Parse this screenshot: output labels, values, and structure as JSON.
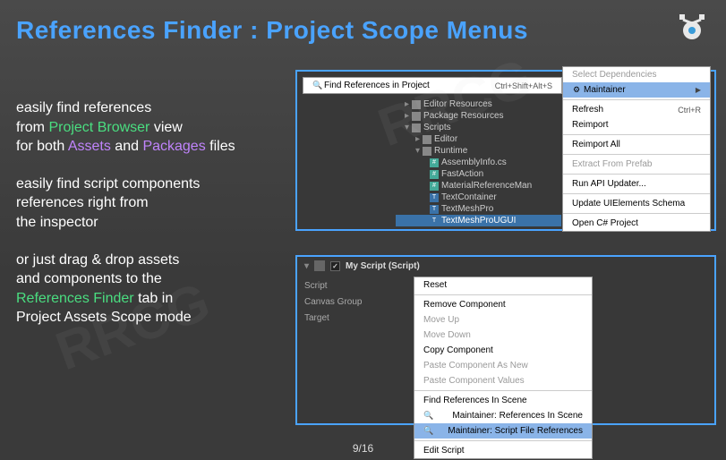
{
  "title": "References Finder : Project Scope Menus",
  "desc": {
    "p1_a": "easily find references",
    "p1_b": "from ",
    "p1_c": "Project Browser",
    "p1_d": " view",
    "p1_e": "for both ",
    "p1_f": "Assets",
    "p1_g": " and ",
    "p1_h": "Packages",
    "p1_i": " files",
    "p2_a": "easily find script components",
    "p2_b": "references right from",
    "p2_c": "the inspector",
    "p3_a": "or just drag & drop assets",
    "p3_b": "and components to the",
    "p3_c": "References Finder",
    "p3_d": " tab in",
    "p3_e": "Project Assets Scope mode"
  },
  "menu1_top": {
    "find": "Find References in Project",
    "shortcut": "Ctrl+Shift+Alt+S"
  },
  "menu1_right": {
    "select_dep": "Select Dependencies",
    "maintainer": "Maintainer",
    "refresh": "Refresh",
    "refresh_sc": "Ctrl+R",
    "reimport": "Reimport",
    "reimport_all": "Reimport All",
    "extract": "Extract From Prefab",
    "api": "Run API Updater...",
    "uielem": "Update UIElements Schema",
    "csproj": "Open C# Project"
  },
  "tree": {
    "editor_res": "Editor Resources",
    "package_res": "Package Resources",
    "scripts": "Scripts",
    "editor": "Editor",
    "runtime": "Runtime",
    "asm": "AssemblyInfo.cs",
    "fast": "FastAction",
    "matref": "MaterialReferenceMan",
    "textc": "TextContainer",
    "tmp": "TextMeshPro",
    "tmpu": "TextMeshProUGUI"
  },
  "inspector": {
    "header": "My Script (Script)",
    "script": "Script",
    "canvas": "Canvas Group",
    "target": "Target"
  },
  "menu2": {
    "reset": "Reset",
    "remove": "Remove Component",
    "moveup": "Move Up",
    "movedown": "Move Down",
    "copy": "Copy Component",
    "pastenew": "Paste Component As New",
    "pastevals": "Paste Component Values",
    "findscene": "Find References In Scene",
    "maint_scene": "Maintainer: References In Scene",
    "maint_file": "Maintainer: Script File References",
    "edit": "Edit Script"
  },
  "page": "9/16"
}
